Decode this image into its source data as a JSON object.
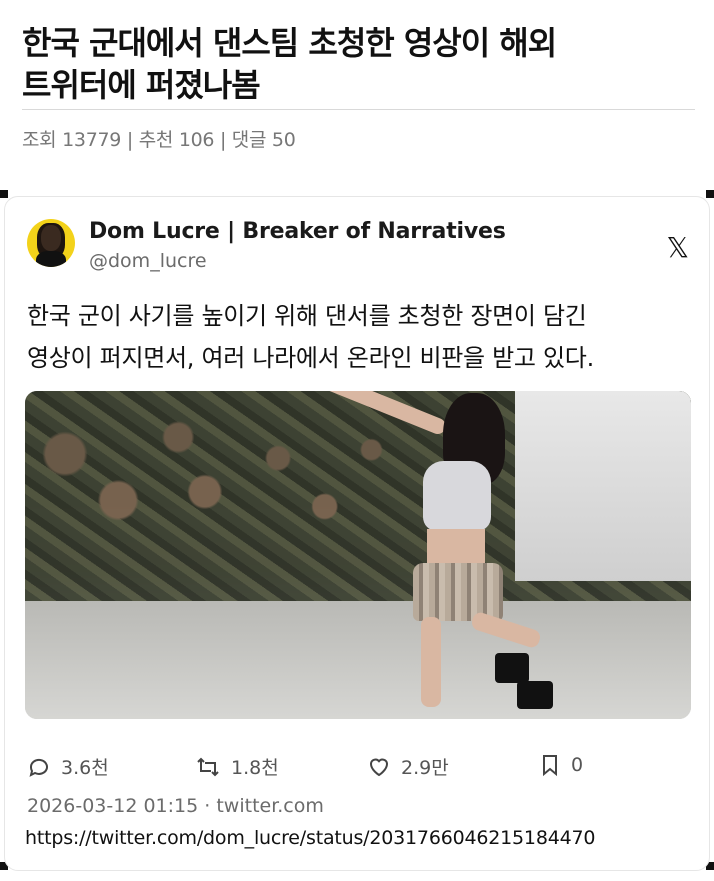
{
  "post": {
    "title_line1": "한국 군대에서 댄스팀 초청한 영상이 해외",
    "title_line2": "트위터에 퍼졌나봄",
    "meta": {
      "views_label": "조회",
      "views": "13779",
      "recommend_label": "추천",
      "recommend": "106",
      "comments_label": "댓글",
      "comments": "50",
      "separator": "|"
    }
  },
  "tweet": {
    "author_name": "Dom Lucre | Breaker of Narratives",
    "author_handle": "@dom_lucre",
    "platform_icon": "x-logo",
    "text_line1": "한국 군이 사기를 높이기 위해 댄서를 초청한 장면이 담긴",
    "text_line2": "영상이 퍼지면서, 여러 나라에서 온라인 비판을 받고 있다.",
    "stats": {
      "replies": "3.6천",
      "retweets": "1.8천",
      "likes": "2.9만",
      "bookmarks": "0"
    },
    "timestamp": "2026-03-12 01:15",
    "source": "· twitter.com",
    "url": "https://twitter.com/dom_lucre/status/2031766046215184470"
  },
  "icons": {
    "reply": "speech-bubble-icon",
    "retweet": "retweet-icon",
    "like": "heart-icon",
    "bookmark": "bookmark-icon"
  }
}
